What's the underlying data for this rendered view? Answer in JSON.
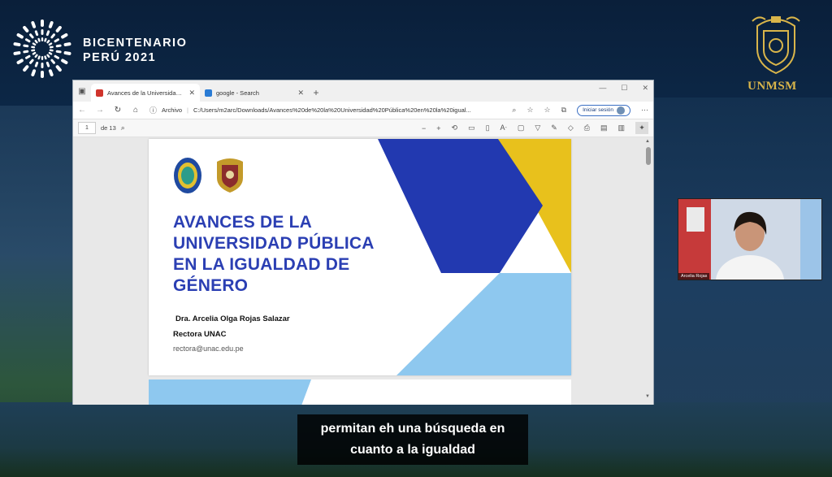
{
  "event": {
    "brand_line1": "BICENTENARIO",
    "brand_line2": "PERÚ 2021",
    "university": "UNMSM"
  },
  "browser": {
    "tabs": [
      {
        "title": "Avances de la Universidad Públic",
        "active": true,
        "favicon_color": "#d0342c"
      },
      {
        "title": "google - Search",
        "active": false,
        "favicon_color": "#2a7bd4"
      }
    ],
    "address": {
      "file_label": "Archivo",
      "url": "C:/Users/m2arc/Downloads/Avances%20de%20la%20Universidad%20Pública%20en%20la%20igual..."
    },
    "signin_label": "Iniciar sesión",
    "pdf": {
      "page_current": "1",
      "page_total": "de 13"
    }
  },
  "slide": {
    "title": "AVANCES DE LA UNIVERSIDAD PÚBLICA EN LA IGUALDAD DE GÉNERO",
    "author": "Dra. Arcelia Olga Rojas Salazar",
    "role": "Rectora UNAC",
    "email": "rectora@unac.edu.pe",
    "colors": {
      "blue": "#2239b0",
      "yellow": "#e8c11c",
      "light_blue": "#8ec8ef",
      "title": "#2b3fb3"
    }
  },
  "webcam": {
    "name_label": "Arcelia Rojas"
  },
  "subtitle": {
    "line1": "permitan eh una búsqueda en",
    "line2": "cuanto a la igualdad"
  }
}
